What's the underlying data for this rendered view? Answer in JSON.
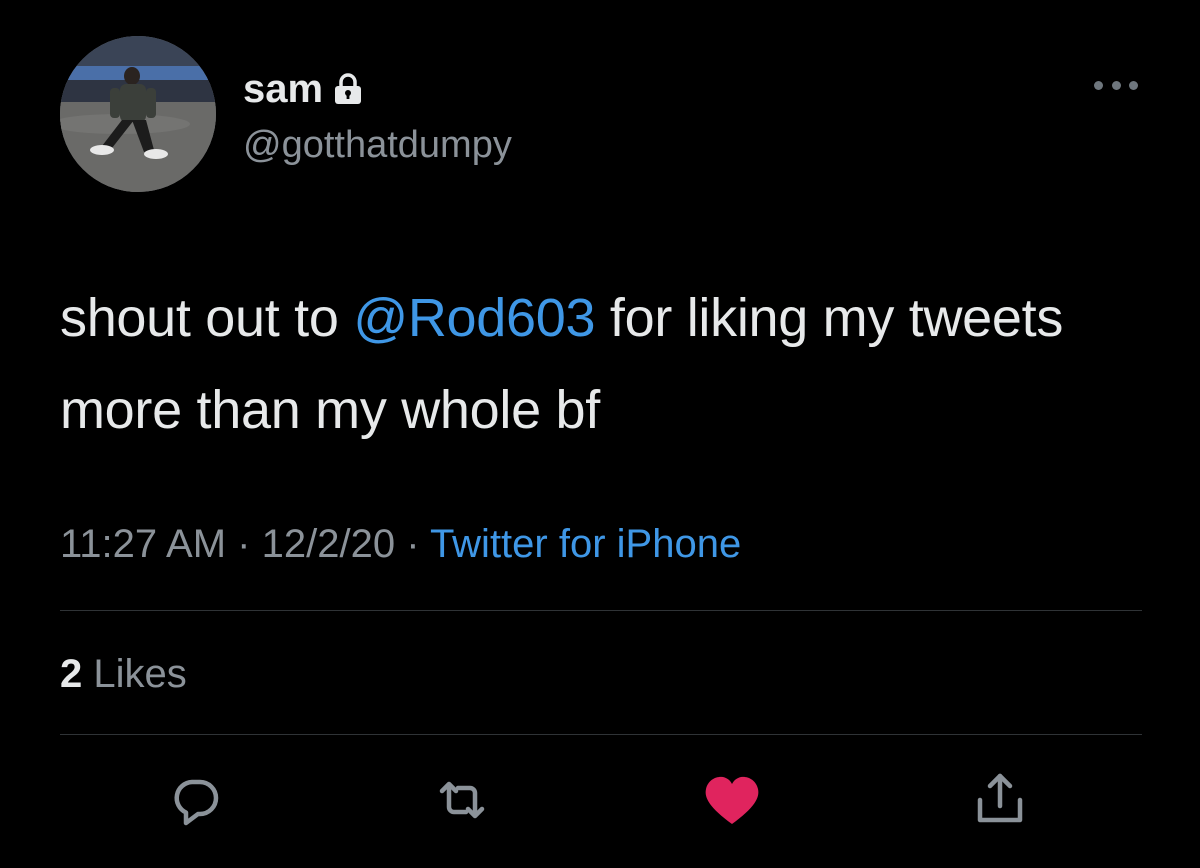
{
  "user": {
    "display_name": "sam",
    "handle": "@gotthatdumpy",
    "protected_icon": "lock-icon"
  },
  "tweet": {
    "text_before": "shout out to ",
    "mention": "@Rod603",
    "text_after": " for liking my tweets more than my whole bf"
  },
  "meta": {
    "time": "11:27 AM",
    "separator": "·",
    "date": "12/2/20",
    "source": "Twitter for iPhone"
  },
  "stats": {
    "likes_count": "2",
    "likes_label": "Likes"
  },
  "actions": {
    "reply": "reply-icon",
    "retweet": "retweet-icon",
    "like": "heart-icon",
    "share": "share-icon",
    "more": "more-options-icon"
  },
  "colors": {
    "background": "#000000",
    "link": "#3f97e6",
    "secondary_text": "#8b9299",
    "like_active": "#e0245e"
  }
}
